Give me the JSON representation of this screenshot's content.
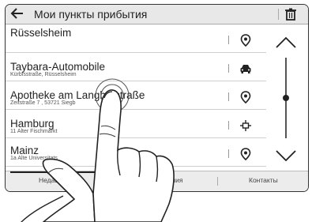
{
  "header": {
    "back_icon": "arrow-left-icon",
    "title": "Мои пункты прибытия",
    "trash_icon": "trash-icon"
  },
  "destinations": [
    {
      "name": "Rüsselsheim",
      "address": "",
      "icon": "pin-icon"
    },
    {
      "name": "Taybara-Automobile",
      "address": "Kürbisstraße, Rüsselsheim",
      "icon": "car-icon"
    },
    {
      "name": "Apotheke am Langba   straße",
      "address": "Zeitstraße 7 , 53721 Siegb",
      "icon": "pin-icon"
    },
    {
      "name": "Hamburg",
      "address": "11 Alter Fischmarkt",
      "icon": "crosshair-icon"
    },
    {
      "name": "Mainz",
      "address": "1a Alte Universitats",
      "icon": "pin-icon"
    }
  ],
  "scroll": {
    "up_icon": "chevron-up-icon",
    "down_icon": "chevron-down-icon",
    "position": 0.45
  },
  "tabs": [
    "Недавние",
    "Предпочтения",
    "Контакты"
  ],
  "active_tab": "Недавние",
  "colors": {
    "header_bg": "#e8e8e8",
    "tab_bg": "#ececec",
    "border": "#333333"
  }
}
